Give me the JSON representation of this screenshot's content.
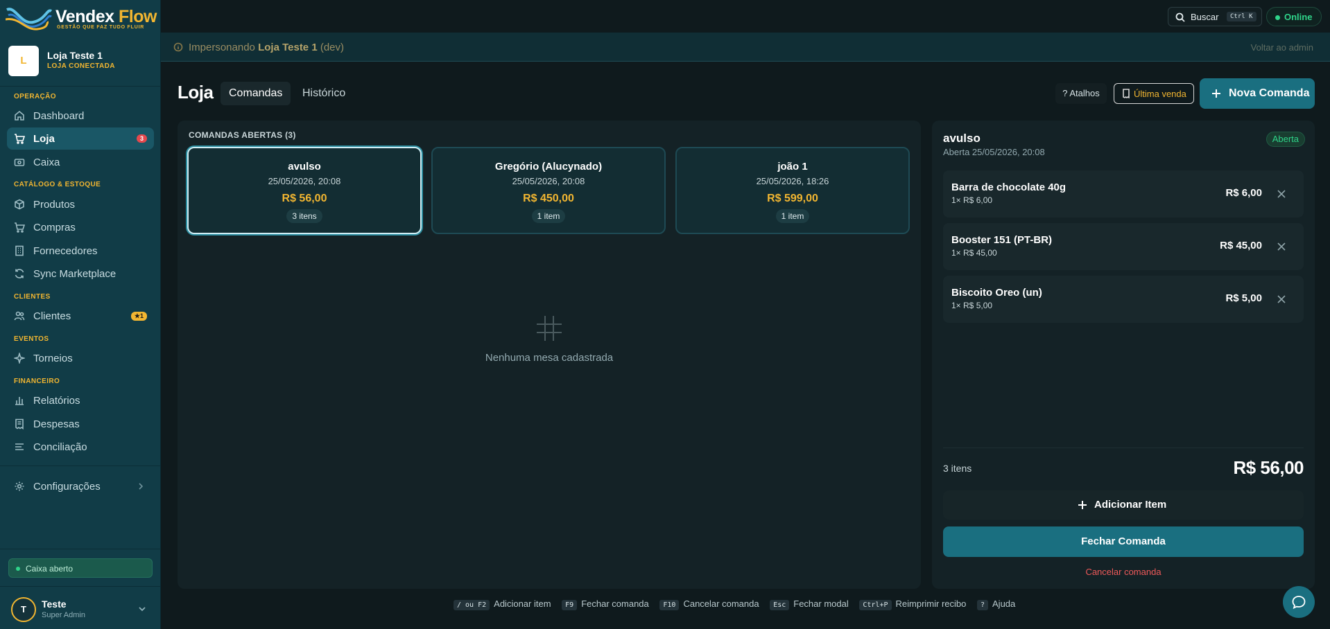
{
  "brand": {
    "name_part1": "Vendex",
    "name_part2": " Flow",
    "tagline": "GESTÃO QUE FAZ TUDO FLUIR"
  },
  "store": {
    "initial": "L",
    "name": "Loja Teste 1",
    "status": "LOJA CONECTADA"
  },
  "sidebar": {
    "sections": {
      "operacao": "OPERAÇÃO",
      "catalogo": "CATÁLOGO & ESTOQUE",
      "clientes": "CLIENTES",
      "eventos": "EVENTOS",
      "financeiro": "FINANCEIRO"
    },
    "items": {
      "dashboard": "Dashboard",
      "loja": "Loja",
      "loja_badge": "3",
      "caixa": "Caixa",
      "produtos": "Produtos",
      "compras": "Compras",
      "fornecedores": "Fornecedores",
      "sync": "Sync Marketplace",
      "clientes": "Clientes",
      "clientes_badge": "★1",
      "torneios": "Torneios",
      "relatorios": "Relatórios",
      "despesas": "Despesas",
      "conciliacao": "Conciliação",
      "configuracoes": "Configurações"
    },
    "caixa_status": "Caixa aberto",
    "user": {
      "initial": "T",
      "name": "Teste",
      "role": "Super Admin"
    }
  },
  "topbar": {
    "search_label": "Buscar",
    "search_shortcut": "Ctrl K",
    "online_label": "Online"
  },
  "impersonation": {
    "prefix": "Impersonando ",
    "store": "Loja Teste 1",
    "suffix": " (dev)",
    "back_label": "Voltar ao admin"
  },
  "page": {
    "title": "Loja",
    "tabs": [
      "Comandas",
      "Histórico"
    ],
    "atalhos_label": "? Atalhos",
    "ultima_venda_label": "Última venda",
    "nova_comanda_label": "Nova Comanda"
  },
  "comandas": {
    "heading": "COMANDAS ABERTAS (3)",
    "orders": [
      {
        "name": "avulso",
        "date": "25/05/2026, 20:08",
        "total": "R$ 56,00",
        "count": "3 itens"
      },
      {
        "name": "Gregório (Alucynado)",
        "date": "25/05/2026, 20:08",
        "total": "R$ 450,00",
        "count": "1 item"
      },
      {
        "name": "joão 1",
        "date": "25/05/2026, 18:26",
        "total": "R$ 599,00",
        "count": "1 item"
      }
    ],
    "empty_text": "Nenhuma mesa cadastrada"
  },
  "detail": {
    "title": "avulso",
    "date": "Aberta 25/05/2026, 20:08",
    "status": "Aberta",
    "items": [
      {
        "name": "Barra de chocolate 40g",
        "qty": "1× R$ 6,00",
        "price": "R$ 6,00"
      },
      {
        "name": "Booster 151 (PT-BR)",
        "qty": "1× R$ 45,00",
        "price": "R$ 45,00"
      },
      {
        "name": "Biscoito Oreo (un)",
        "qty": "1× R$ 5,00",
        "price": "R$ 5,00"
      }
    ],
    "count_label": "3 itens",
    "total": "R$ 56,00",
    "add_item_label": "Adicionar Item",
    "fechar_label": "Fechar Comanda",
    "cancelar_label": "Cancelar comanda"
  },
  "shortcuts": [
    {
      "key": "/ ou F2",
      "label": "Adicionar item"
    },
    {
      "key": "F9",
      "label": "Fechar comanda"
    },
    {
      "key": "F10",
      "label": "Cancelar comanda"
    },
    {
      "key": "Esc",
      "label": "Fechar modal"
    },
    {
      "key": "Ctrl+P",
      "label": "Reimprimir recibo"
    },
    {
      "key": "?",
      "label": "Ajuda"
    }
  ],
  "colors": {
    "accent_gold": "#f2b631",
    "primary_teal": "#1a6f80",
    "online_green": "#2fd48a",
    "danger_red": "#f05a5a"
  }
}
